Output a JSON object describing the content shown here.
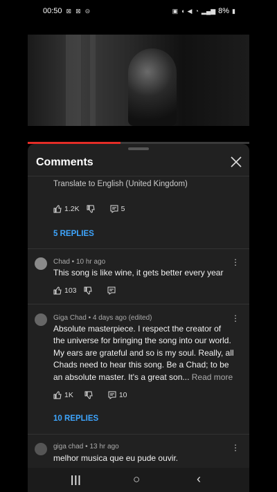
{
  "status_bar": {
    "time": "00:50",
    "battery": "8%"
  },
  "video": {
    "progress_fraction": 0.42
  },
  "sheet": {
    "title": "Comments"
  },
  "comments": [
    {
      "translate_label": "Translate to English (United Kingdom)",
      "likes": "1.2K",
      "reply_count": "5",
      "replies_label": "5 REPLIES"
    },
    {
      "author": "Chad",
      "time": "10 hr ago",
      "text": "This song is like wine, it gets better every year",
      "likes": "103"
    },
    {
      "author": "Giga Chad",
      "time": "4 days ago (edited)",
      "text_lines": [
        "Absolute masterpiece. I respect the creator of",
        "the universe for bringing the song into our world.",
        "My ears are grateful and so is my soul. Really, all",
        "Chads need to hear this song. Be a Chad; to be",
        "an absolute master. It's a great son..."
      ],
      "read_more": "Read more",
      "likes": "1K",
      "reply_count": "10",
      "replies_label": "10 REPLIES"
    },
    {
      "author": "giga chad",
      "time": "13 hr ago",
      "text": "melhor musica que eu pude ouvir."
    }
  ],
  "meta_separator": " • ",
  "icons": [
    "like-icon",
    "dislike-icon",
    "reply-icon",
    "more-vert-icon",
    "close-icon",
    "recents-icon",
    "home-icon",
    "back-icon"
  ]
}
